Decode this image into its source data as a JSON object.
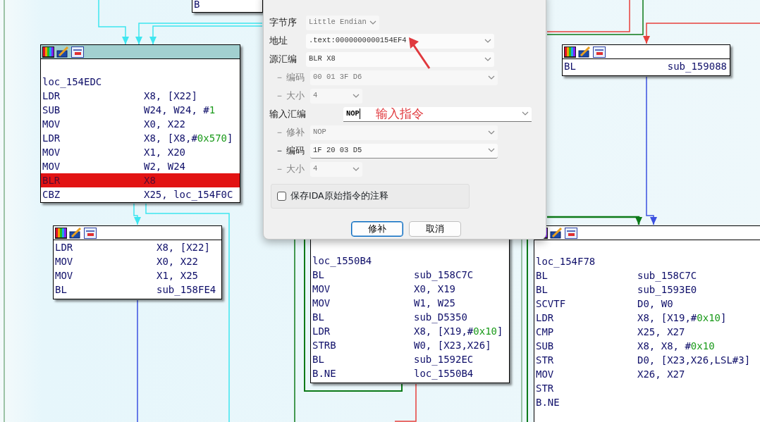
{
  "graph": {
    "blocks": [
      {
        "selected": false,
        "header": false,
        "lines": [
          {
            "kind": "instruction",
            "mnemonic": "B"
          }
        ]
      },
      {
        "selected": true,
        "header": true,
        "lines": [
          {
            "kind": "label",
            "text": "loc_154EDC"
          },
          {
            "kind": "instruction",
            "mnemonic": "LDR",
            "operand": [
              {
                "kind": "plain",
                "text": "X8, [X22]"
              }
            ]
          },
          {
            "kind": "instruction",
            "mnemonic": "SUB",
            "operand": [
              {
                "kind": "plain",
                "text": "W24, W24, #"
              },
              {
                "kind": "number",
                "text": "1"
              }
            ]
          },
          {
            "kind": "instruction",
            "mnemonic": "MOV",
            "operand": [
              {
                "kind": "plain",
                "text": "X0, X22"
              }
            ]
          },
          {
            "kind": "instruction",
            "mnemonic": "LDR",
            "operand": [
              {
                "kind": "plain",
                "text": "X8, [X8,#"
              },
              {
                "kind": "number",
                "text": "0x570"
              },
              {
                "kind": "plain",
                "text": "]"
              }
            ]
          },
          {
            "kind": "instruction",
            "mnemonic": "MOV",
            "operand": [
              {
                "kind": "plain",
                "text": "X1, X20"
              }
            ]
          },
          {
            "kind": "instruction",
            "mnemonic": "MOV",
            "operand": [
              {
                "kind": "plain",
                "text": "W2, W24"
              }
            ]
          },
          {
            "kind": "instruction",
            "mnemonic": "BLR",
            "highlighted": true,
            "operand": [
              {
                "kind": "plain",
                "text": "X8"
              }
            ]
          },
          {
            "kind": "instruction",
            "mnemonic": "CBZ",
            "operand": [
              {
                "kind": "plain",
                "text": "X25, loc_154F0C"
              }
            ]
          }
        ]
      },
      {
        "selected": false,
        "header": true,
        "lines": [
          {
            "kind": "instruction",
            "mnemonic": "LDR",
            "operand": [
              {
                "kind": "plain",
                "text": "X8, [X22]"
              }
            ]
          },
          {
            "kind": "instruction",
            "mnemonic": "MOV",
            "operand": [
              {
                "kind": "plain",
                "text": "X0, X22"
              }
            ]
          },
          {
            "kind": "instruction",
            "mnemonic": "MOV",
            "operand": [
              {
                "kind": "plain",
                "text": "X1, X25"
              }
            ]
          },
          {
            "kind": "instruction",
            "mnemonic": "BL",
            "operand": [
              {
                "kind": "plain",
                "text": "sub_158FE4"
              }
            ]
          }
        ]
      },
      {
        "selected": false,
        "header": true,
        "lines": [
          {
            "kind": "instruction",
            "mnemonic": "BL",
            "operand": [
              {
                "kind": "plain",
                "text": "sub_159088"
              }
            ]
          }
        ]
      },
      {
        "selected": false,
        "header": false,
        "lines": [
          {
            "kind": "label",
            "text": "loc_1550B4"
          },
          {
            "kind": "instruction",
            "mnemonic": "BL",
            "operand": [
              {
                "kind": "plain",
                "text": "sub_158C7C"
              }
            ]
          },
          {
            "kind": "instruction",
            "mnemonic": "MOV",
            "operand": [
              {
                "kind": "plain",
                "text": "X0, X19"
              }
            ]
          },
          {
            "kind": "instruction",
            "mnemonic": "MOV",
            "operand": [
              {
                "kind": "plain",
                "text": "W1, W25"
              }
            ]
          },
          {
            "kind": "instruction",
            "mnemonic": "BL",
            "operand": [
              {
                "kind": "plain",
                "text": "sub_D5350"
              }
            ]
          },
          {
            "kind": "instruction",
            "mnemonic": "LDR",
            "operand": [
              {
                "kind": "plain",
                "text": "X8, [X19,#"
              },
              {
                "kind": "number",
                "text": "0x10"
              },
              {
                "kind": "plain",
                "text": "]"
              }
            ]
          },
          {
            "kind": "instruction",
            "mnemonic": "STRB",
            "operand": [
              {
                "kind": "plain",
                "text": "W0, [X23,X26]"
              }
            ]
          },
          {
            "kind": "instruction",
            "mnemonic": "BL",
            "operand": [
              {
                "kind": "plain",
                "text": "sub_1592EC"
              }
            ]
          },
          {
            "kind": "instruction",
            "mnemonic": "B.NE",
            "operand": [
              {
                "kind": "plain",
                "text": "loc_1550B4"
              }
            ]
          }
        ]
      },
      {
        "selected": false,
        "header": true,
        "lines": [
          {
            "kind": "label",
            "text": "loc_154F78"
          },
          {
            "kind": "instruction",
            "mnemonic": "BL",
            "operand": [
              {
                "kind": "plain",
                "text": "sub_158C7C"
              }
            ]
          },
          {
            "kind": "instruction",
            "mnemonic": "BL",
            "operand": [
              {
                "kind": "plain",
                "text": "sub_1593E0"
              }
            ]
          },
          {
            "kind": "instruction",
            "mnemonic": "SCVTF",
            "operand": [
              {
                "kind": "plain",
                "text": "D0, W0"
              }
            ]
          },
          {
            "kind": "instruction",
            "mnemonic": "LDR",
            "operand": [
              {
                "kind": "plain",
                "text": "X8, [X19,#"
              },
              {
                "kind": "number",
                "text": "0x10"
              },
              {
                "kind": "plain",
                "text": "]"
              }
            ]
          },
          {
            "kind": "instruction",
            "mnemonic": "CMP",
            "operand": [
              {
                "kind": "plain",
                "text": "X25, X27"
              }
            ]
          },
          {
            "kind": "instruction",
            "mnemonic": "SUB",
            "operand": [
              {
                "kind": "plain",
                "text": "X8, X8, #"
              },
              {
                "kind": "number",
                "text": "0x10"
              }
            ]
          },
          {
            "kind": "instruction",
            "mnemonic": "STR",
            "operand": [
              {
                "kind": "plain",
                "text": "D0, [X23,X26,LSL#3]"
              }
            ]
          },
          {
            "kind": "instruction",
            "mnemonic": "MOV",
            "operand": [
              {
                "kind": "plain",
                "text": "X26, X27"
              }
            ]
          },
          {
            "kind": "instruction",
            "mnemonic": "STR"
          },
          {
            "kind": "instruction",
            "mnemonic": "B.NE"
          }
        ]
      }
    ]
  },
  "dialog": {
    "rows": [
      {
        "kind": "field",
        "label": "字节序",
        "value": "Little Endian",
        "disabled": true
      },
      {
        "kind": "field",
        "label": "地址",
        "value": ".text:0000000000154EF4",
        "disabled": false
      },
      {
        "kind": "field",
        "label": "源汇编",
        "value": "BLR X8",
        "disabled": false
      },
      {
        "kind": "subfield",
        "dash": "－",
        "label": "编码",
        "value": "00 01 3F D6",
        "disabled": true
      },
      {
        "kind": "subfield",
        "dash": "－",
        "label": "大小",
        "value": "4",
        "disabled": true
      },
      {
        "kind": "input",
        "label": "输入汇编",
        "value": "NOP",
        "disabled": false
      },
      {
        "kind": "subfield",
        "dash": "－",
        "label": "修补",
        "value": "NOP",
        "disabled": true
      },
      {
        "kind": "subfield",
        "dash": "－",
        "label": "编码",
        "value": "1F 20 03 D5",
        "disabled": false
      },
      {
        "kind": "subfield",
        "dash": "－",
        "label": "大小",
        "value": "4",
        "disabled": true
      }
    ],
    "checkbox": {
      "label": "保存IDA原始指令的注释",
      "checked": false
    },
    "buttons": [
      {
        "label": "修补",
        "default": true
      },
      {
        "label": "取消",
        "default": false
      }
    ],
    "annotation": {
      "text": "输入指令"
    }
  }
}
